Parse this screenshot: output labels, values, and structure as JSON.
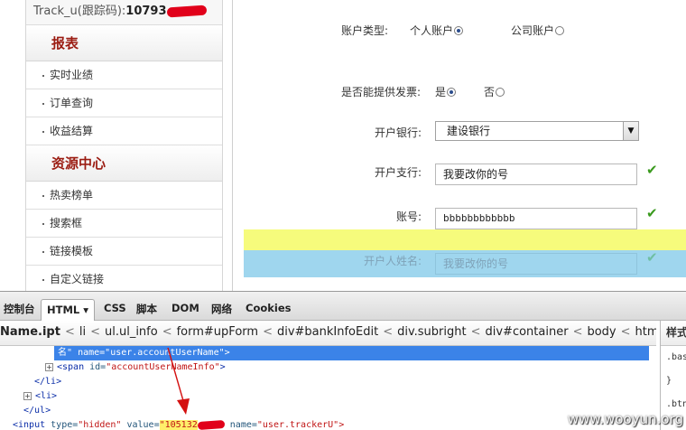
{
  "sidebar": {
    "track_label": "Track_u(跟踪码):",
    "track_value": "10793",
    "sections": [
      {
        "title": "报表",
        "items": [
          "实时业绩",
          "订单查询",
          "收益结算"
        ]
      },
      {
        "title": "资源中心",
        "items": [
          "热卖榜单",
          "搜索框",
          "链接模板",
          "自定义链接"
        ]
      }
    ]
  },
  "form": {
    "account_type_label": "账户类型:",
    "account_type_options": [
      "个人账户",
      "公司账户"
    ],
    "account_type_selected": "个人账户",
    "invoice_label": "是否能提供发票:",
    "invoice_options": [
      "是",
      "否"
    ],
    "invoice_selected": "是",
    "bank_label": "开户银行:",
    "bank_value": "建设银行",
    "branch_label": "开户支行:",
    "branch_value": "我要改你的号",
    "account_no_label": "账号:",
    "account_no_value": "bbbbbbbbbbbb",
    "holder_label": "开户人姓名:",
    "holder_value": "我要改你的号"
  },
  "devtools": {
    "tabs": [
      "控制台",
      "HTML ▾",
      "CSS",
      "脚本",
      "DOM",
      "网络",
      "Cookies"
    ],
    "active_tab": "HTML ▾",
    "breadcrumb": [
      "Name.ipt",
      "li",
      "ul.ul_info",
      "form#upForm",
      "div#bankInfoEdit",
      "div.subright",
      "div#container",
      "body",
      "html"
    ],
    "code": {
      "line1_text": "名\"",
      "line1_attr": "name=",
      "line1_value": "\"user.accountUserName\"",
      "line2_tag": "<span",
      "line2_attr": "id=",
      "line2_value": "\"accountUserNameInfo\"",
      "line3": "</li>",
      "line4": "<li>",
      "line5": "</ul>",
      "line6_tag": "<input",
      "line6_type_attr": "type=",
      "line6_type_value": "\"hidden\"",
      "line6_value_attr": "value=",
      "line6_value_value": "\"105132",
      "line6_name_attr": "name=",
      "line6_name_value": "\"user.trackerU\">"
    },
    "side_panel": {
      "tab": "样式",
      "lines": [
        ".bas",
        "}",
        ".btn"
      ]
    }
  },
  "watermark": "www.wooyun.org",
  "colors": {
    "section_title": "#9b1c12",
    "selection": "#3b83e8",
    "check": "#3a9a1e",
    "highlight_yellow": "#f6fb7c",
    "highlight_blue": "#9fd6ee"
  }
}
